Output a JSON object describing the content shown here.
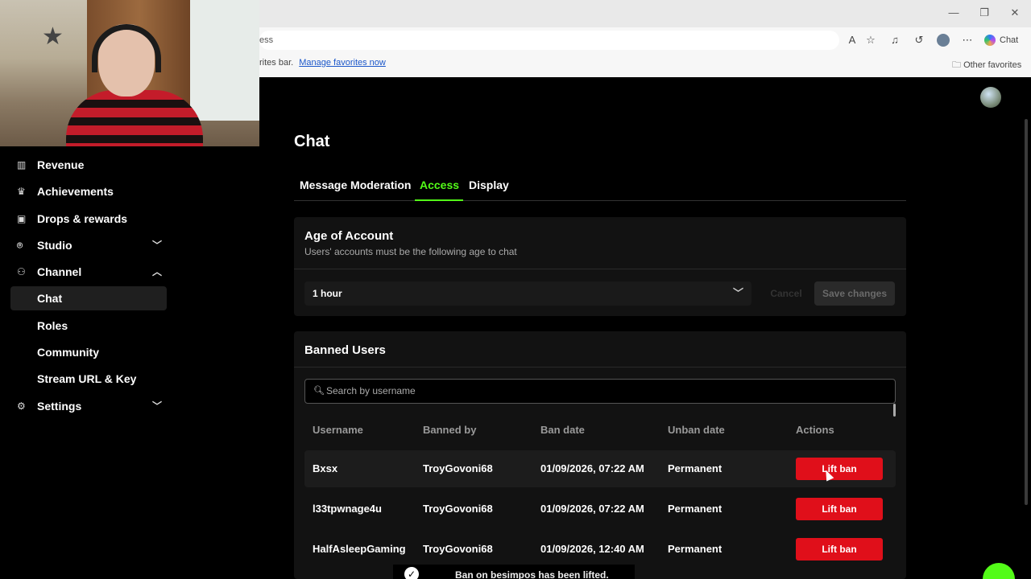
{
  "browser": {
    "address_text": "ess",
    "favbar_text": "rites bar.",
    "favbar_link": "Manage favorites now",
    "other_favorites": "Other favorites",
    "copilot_label": "Chat"
  },
  "sidebar": {
    "items": [
      {
        "label": "Revenue",
        "icon": "chart-icon"
      },
      {
        "label": "Achievements",
        "icon": "trophy-icon"
      },
      {
        "label": "Drops & rewards",
        "icon": "gift-icon"
      },
      {
        "label": "Studio",
        "icon": "studio-icon",
        "chevron": "down"
      },
      {
        "label": "Channel",
        "icon": "channel-icon",
        "chevron": "up"
      },
      {
        "label": "Chat",
        "active": true
      },
      {
        "label": "Roles"
      },
      {
        "label": "Community"
      },
      {
        "label": "Stream URL & Key"
      },
      {
        "label": "Settings",
        "icon": "gear-icon",
        "chevron": "down"
      }
    ]
  },
  "page": {
    "title": "Chat",
    "tabs": [
      {
        "label": "Message Moderation",
        "active": false
      },
      {
        "label": "Access",
        "active": true
      },
      {
        "label": "Display",
        "active": false
      }
    ]
  },
  "age_card": {
    "title": "Age of Account",
    "subtitle": "Users' accounts must be the following age to chat",
    "selected": "1 hour",
    "cancel_label": "Cancel",
    "save_label": "Save changes"
  },
  "banned_card": {
    "title": "Banned Users",
    "search_placeholder": "Search by username",
    "columns": [
      "Username",
      "Banned by",
      "Ban date",
      "Unban date",
      "Actions"
    ],
    "rows": [
      {
        "username": "Bxsx",
        "banned_by": "TroyGovoni68",
        "ban_date": "01/09/2026, 07:22 AM",
        "unban_date": "Permanent",
        "action": "Lift ban"
      },
      {
        "username": "l33tpwnage4u",
        "banned_by": "TroyGovoni68",
        "ban_date": "01/09/2026, 07:22 AM",
        "unban_date": "Permanent",
        "action": "Lift ban"
      },
      {
        "username": "HalfAsleepGaming",
        "banned_by": "TroyGovoni68",
        "ban_date": "01/09/2026, 12:40 AM",
        "unban_date": "Permanent",
        "action": "Lift ban"
      }
    ]
  },
  "toast": {
    "message": "Ban on besimpos has been lifted."
  },
  "colors": {
    "accent": "#53fc18",
    "danger": "#e00f1a"
  }
}
